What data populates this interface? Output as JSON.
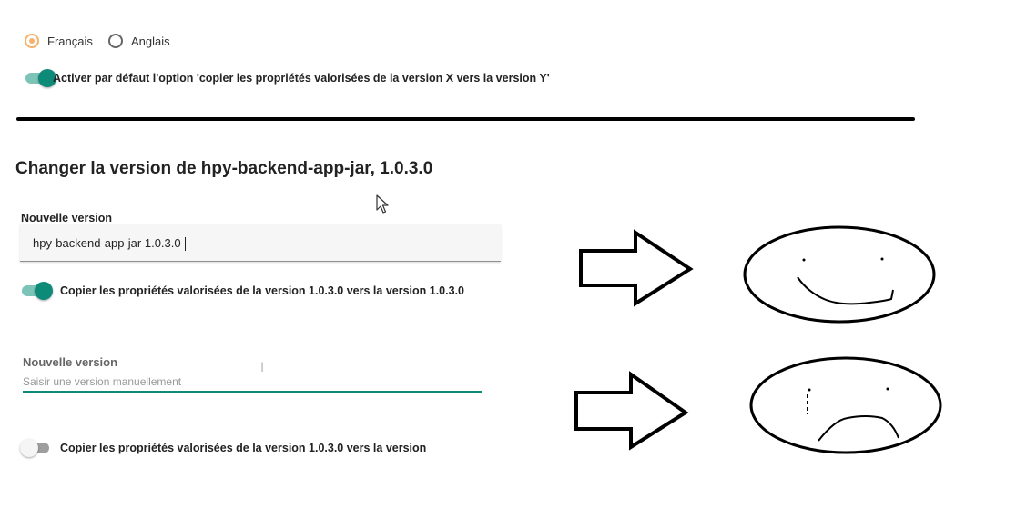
{
  "language": {
    "options": [
      {
        "label": "Français",
        "selected": true
      },
      {
        "label": "Anglais",
        "selected": false
      }
    ],
    "selected_color": "#f6b26b"
  },
  "default_option": {
    "label": "Activer par défaut l'option 'copier les propriétés valorisées de la version X vers la version Y'",
    "enabled": true
  },
  "dialog": {
    "title": "Changer la version de hpy-backend-app-jar, 1.0.3.0",
    "field1": {
      "label": "Nouvelle version",
      "value": "hpy-backend-app-jar 1.0.3.0"
    },
    "copy_toggle_1": {
      "label": "Copier les propriétés valorisées de la version 1.0.3.0 vers la version 1.0.3.0",
      "enabled": true
    },
    "field2": {
      "label": "Nouvelle version",
      "placeholder": "Saisir une version manuellement",
      "value": ""
    },
    "copy_toggle_2": {
      "label": "Copier les propriétés valorisées de la version 1.0.3.0 vers la version",
      "enabled": false
    }
  },
  "annotations": {
    "arrow_1_icon": "right-arrow-outline",
    "face_1_icon": "happy-face-drawing",
    "arrow_2_icon": "right-arrow-outline",
    "face_2_icon": "sad-face-drawing"
  },
  "colors": {
    "accent": "#0d8a78",
    "toggle_track_on": "#7dc4b8",
    "divider": "#000000"
  }
}
